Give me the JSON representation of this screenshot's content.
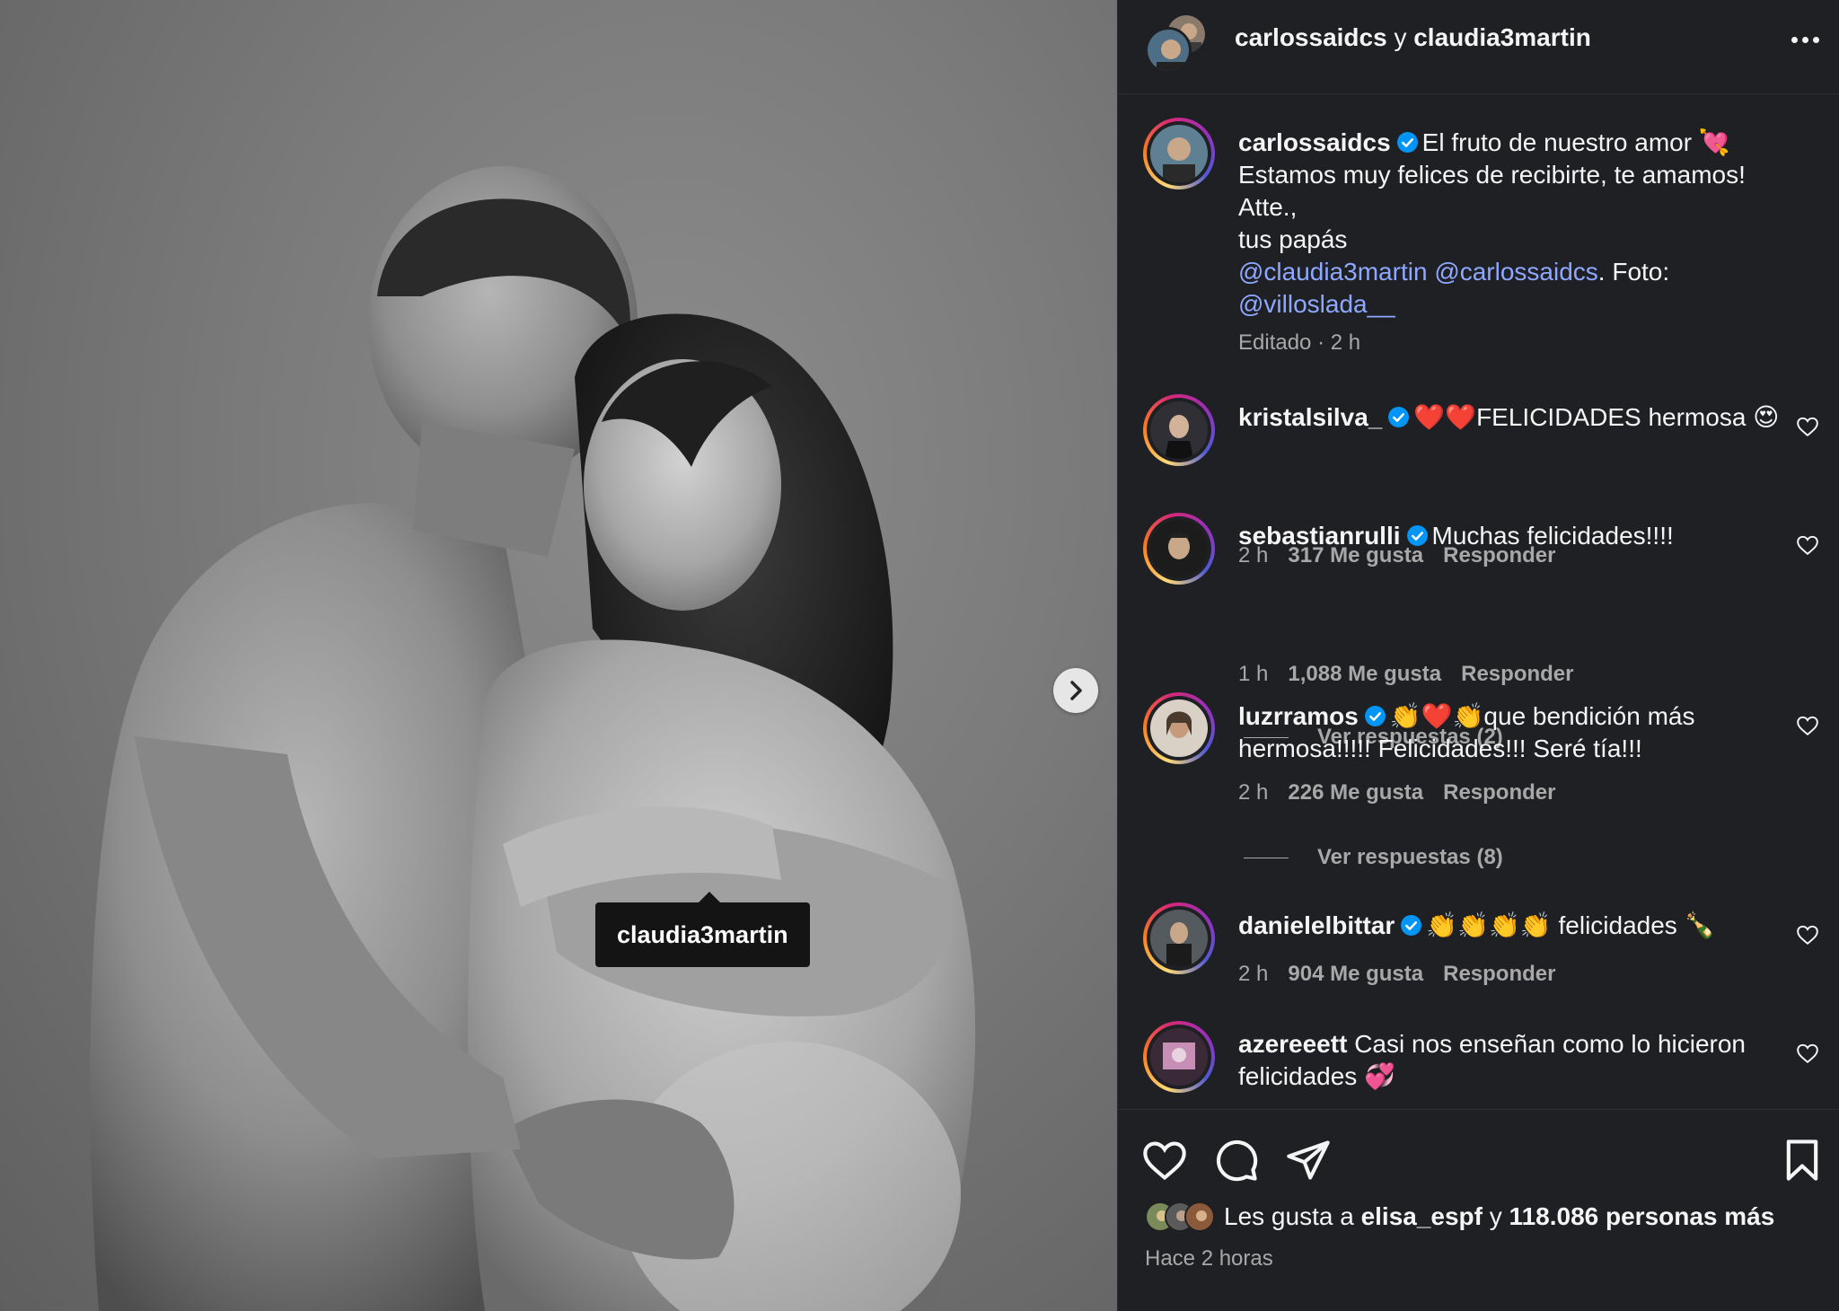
{
  "photo": {
    "tag_label": "claudia3martin"
  },
  "header": {
    "user_a": "carlossaidcs",
    "joiner": " y ",
    "user_b": "claudia3martin"
  },
  "caption": {
    "username": "carlossaidcs",
    "line1": "El fruto de nuestro amor 💘",
    "line2": "Estamos muy felices de recibirte, te amamos!",
    "line3": "Atte.,",
    "line4": "tus papás",
    "mention1": "@claudia3martin",
    "mention2": "@carlossaidcs",
    "foto_label": ". Foto:",
    "mention3": "@villoslada__",
    "meta": "Editado · 2 h"
  },
  "comments": [
    {
      "username": "kristalsilva_",
      "text": "❤️❤️FELICIDADES hermosa 😍",
      "time": "2 h",
      "likes": "317 Me gusta",
      "reply": "Responder"
    },
    {
      "username": "sebastianrulli",
      "text": "Muchas felicidades!!!!",
      "time": "1 h",
      "likes": "1,088 Me gusta",
      "reply": "Responder",
      "view_replies": "Ver respuestas (2)"
    },
    {
      "username": "luzrramos",
      "text": "👏❤️👏que bendición más hermosa!!!!! Felicidades!!! Seré tía!!!",
      "time": "2 h",
      "likes": "226 Me gusta",
      "reply": "Responder",
      "view_replies": "Ver respuestas (8)"
    },
    {
      "username": "danielelbittar",
      "text": "👏👏👏👏 felicidades 🍾",
      "time": "2 h",
      "likes": "904 Me gusta",
      "reply": "Responder"
    },
    {
      "username": "azereeett",
      "text": "Casi nos enseñan como lo hicieron felicidades 💞"
    }
  ],
  "likes": {
    "prefix": "Les gusta a ",
    "user": "elisa_espf",
    "middle": " y ",
    "count": "118.086 personas más"
  },
  "time_ago": "Hace 2 horas",
  "colors": {
    "panel_bg": "#1f2024",
    "text": "#f5f5f5",
    "muted": "#a8a8a8",
    "mention": "#8fa8ff",
    "verified": "#0095f6"
  },
  "icons": [
    "more-icon",
    "verified-icon",
    "heart-icon",
    "comment-icon",
    "share-icon",
    "bookmark-icon",
    "chevron-right-icon"
  ]
}
